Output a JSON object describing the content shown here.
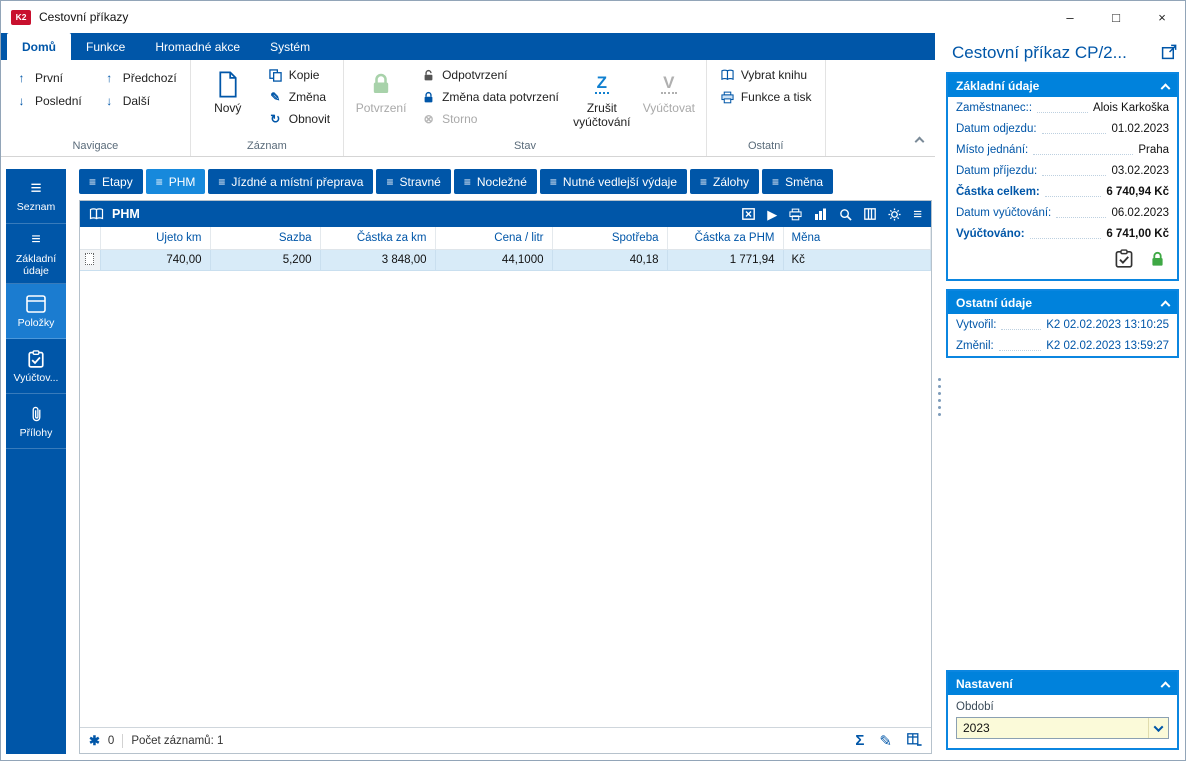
{
  "colors": {
    "primary_blue": "#0056A8",
    "accent_blue": "#0082DC",
    "active_tab_blue": "#1789DC",
    "row_highlight": "#D8EBF8",
    "lock_green": "#3EA844",
    "combo_yellow": "#FBFAD9",
    "app_icon_red": "#C8102E"
  },
  "icons": {
    "first": "↑",
    "last": "↓",
    "previous": "↑",
    "next": "↓",
    "edit_pencil": "✎",
    "refresh": "↻",
    "storno": "⊗",
    "cancel_billing_letter": "Z",
    "billing_letter": "V",
    "hamburger": "≡",
    "play": "▶",
    "sum": "Σ",
    "filter_asterisk": "✱",
    "minimize": "–",
    "maximize": "□",
    "close": "×"
  },
  "window": {
    "app_badge": "K2",
    "title": "Cestovní příkazy"
  },
  "ribbon": {
    "tabs": [
      {
        "label": "Domů"
      },
      {
        "label": "Funkce"
      },
      {
        "label": "Hromadné akce"
      },
      {
        "label": "Systém"
      }
    ],
    "groups": {
      "navigace": {
        "label": "Navigace",
        "first": "První",
        "last": "Poslední",
        "previous": "Předchozí",
        "next": "Další"
      },
      "zaznam": {
        "label": "Záznam",
        "new": "Nový",
        "copy": "Kopie",
        "change": "Změna",
        "refresh": "Obnovit"
      },
      "stav": {
        "label": "Stav",
        "confirm": "Potvrzení",
        "unconfirm": "Odpotvrzení",
        "change_confirm_date": "Změna data potvrzení",
        "storno": "Storno",
        "cancel_billing": "Zrušit vyúčtování",
        "bill": "Vyúčtovat"
      },
      "ostatni": {
        "label": "Ostatní",
        "select_book": "Vybrat knihu",
        "functions_print": "Funkce a tisk"
      }
    }
  },
  "sidebar": {
    "items": [
      {
        "label": "Seznam"
      },
      {
        "label": "Základní údaje"
      },
      {
        "label": "Položky"
      },
      {
        "label": "Vyúčtov..."
      },
      {
        "label": "Přílohy"
      }
    ]
  },
  "content": {
    "tabs": [
      {
        "label": "Etapy"
      },
      {
        "label": "PHM"
      },
      {
        "label": "Jízdné a místní přeprava"
      },
      {
        "label": "Stravné"
      },
      {
        "label": "Nocležné"
      },
      {
        "label": "Nutné vedlejší výdaje"
      },
      {
        "label": "Zálohy"
      },
      {
        "label": "Směna"
      }
    ],
    "panel": {
      "title": "PHM"
    },
    "table": {
      "columns": [
        "Ujeto km",
        "Sazba",
        "Částka za km",
        "Cena / litr",
        "Spotřeba",
        "Částka za PHM",
        "Měna"
      ],
      "rows": [
        [
          "740,00",
          "5,200",
          "3 848,00",
          "44,1000",
          "40,18",
          "1 771,94",
          "Kč"
        ]
      ]
    },
    "status": {
      "filter_count": "0",
      "records": "Počet záznamů: 1"
    }
  },
  "detail": {
    "title": "Cestovní příkaz CP/2...",
    "basic": {
      "header": "Základní údaje",
      "fields": [
        {
          "label": "Zaměstnanec::",
          "value": "Alois Karkoška"
        },
        {
          "label": "Datum odjezdu:",
          "value": "01.02.2023"
        },
        {
          "label": "Místo jednání:",
          "value": "Praha"
        },
        {
          "label": "Datum příjezdu:",
          "value": "03.02.2023"
        },
        {
          "label": "Částka celkem:",
          "value": "6 740,94 Kč"
        },
        {
          "label": "Datum vyúčtování:",
          "value": "06.02.2023"
        },
        {
          "label": "Vyúčtováno:",
          "value": "6 741,00 Kč"
        }
      ]
    },
    "other": {
      "header": "Ostatní údaje",
      "fields": [
        {
          "label": "Vytvořil:",
          "value": "K2 02.02.2023 13:10:25"
        },
        {
          "label": "Změnil:",
          "value": "K2 02.02.2023 13:59:27"
        }
      ]
    },
    "settings": {
      "header": "Nastavení",
      "period_label": "Období",
      "period_value": "2023"
    }
  }
}
